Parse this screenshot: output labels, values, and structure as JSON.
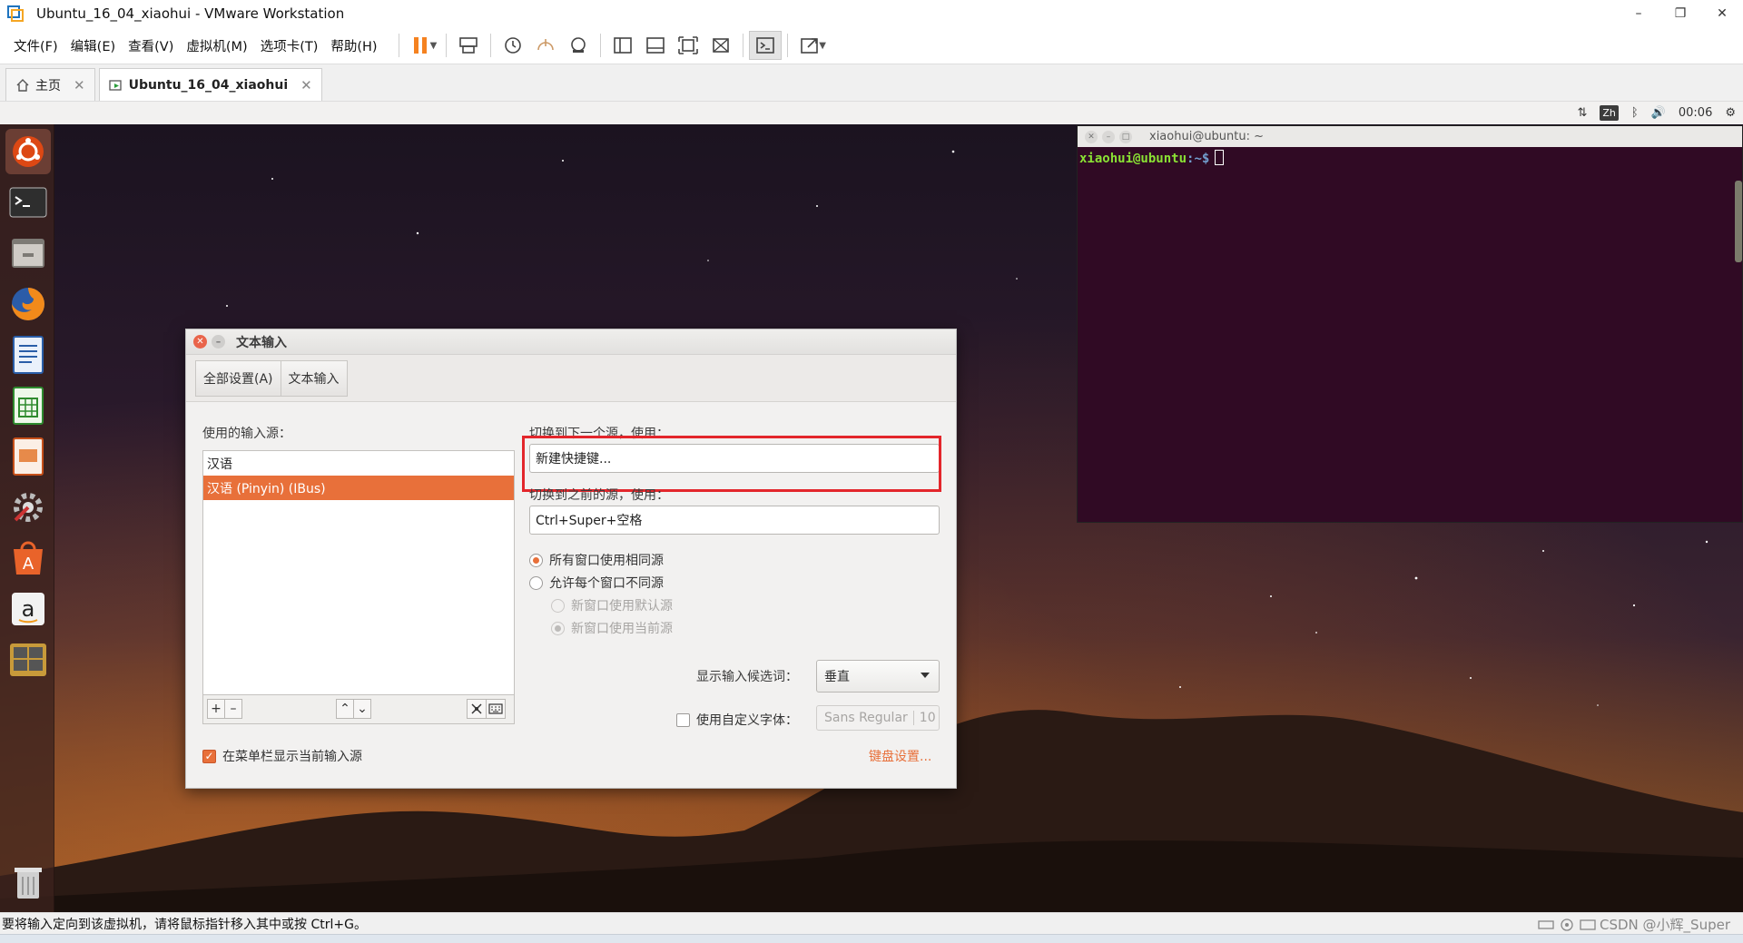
{
  "window": {
    "title": "Ubuntu_16_04_xiaohui - VMware Workstation",
    "minimize": "–",
    "restore": "❐",
    "close": "✕"
  },
  "menubar": {
    "items": [
      "文件(F)",
      "编辑(E)",
      "查看(V)",
      "虚拟机(M)",
      "选项卡(T)",
      "帮助(H)"
    ]
  },
  "tabs": [
    {
      "label": "主页",
      "close": "✕"
    },
    {
      "label": "Ubuntu_16_04_xiaohui",
      "close": "✕"
    }
  ],
  "top_panel": {
    "ime": "Zh",
    "clock": "00:06",
    "arrows": "⇅",
    "bluetooth": "ᛒ",
    "volume": "🔊",
    "gear": "⚙"
  },
  "terminal": {
    "title": "xiaohui@ubuntu: ~",
    "prompt_user": "xiaohui@ubuntu",
    "prompt_path": ":~$"
  },
  "dialog": {
    "title": "文本输入",
    "breadcrumbs": [
      "全部设置(A)",
      "文本输入"
    ],
    "sources_label": "使用的输入源：",
    "sources": [
      "汉语",
      "汉语 (Pinyin) (IBus)"
    ],
    "toolbar": {
      "add": "+",
      "remove": "–",
      "up": "⌃",
      "down": "⌄"
    },
    "next_label": "切换到下一个源，使用：",
    "next_value": "新建快捷键...",
    "prev_label": "切换到之前的源，使用：",
    "prev_value": "Ctrl+Super+空格",
    "radio_same": "所有窗口使用相同源",
    "radio_each": "允许每个窗口不同源",
    "radio_default": "新窗口使用默认源",
    "radio_current": "新窗口使用当前源",
    "candidates_label": "显示输入候选词：",
    "candidates_value": "垂直",
    "custom_font_label": "使用自定义字体：",
    "font_name": "Sans Regular",
    "font_size": "10",
    "show_in_menu": "在菜单栏显示当前输入源",
    "keyboard_settings": "键盘设置..."
  },
  "statusbar": {
    "message": "要将输入定向到该虚拟机，请将鼠标指针移入其中或按 Ctrl+G。",
    "watermark": "CSDN @小辉_Super"
  },
  "colors": {
    "accent": "#e8703a",
    "highlight": "#e3262b",
    "terminal_bg": "#300a24"
  }
}
